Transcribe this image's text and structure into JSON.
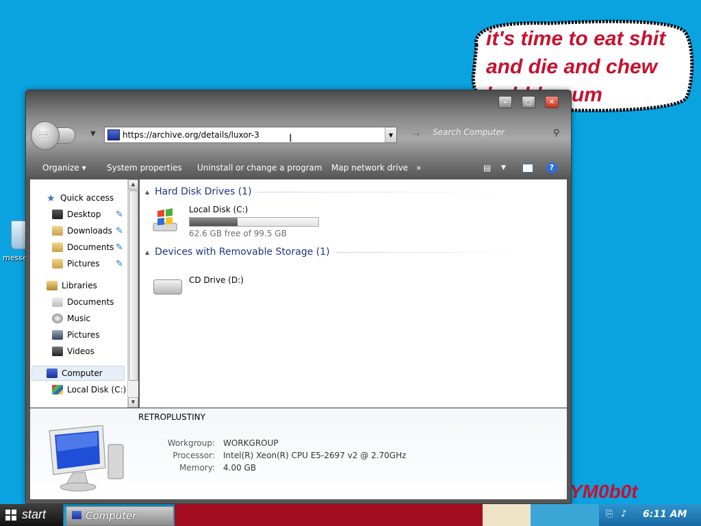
{
  "wallpaper": {
    "bubble_lines": [
      "it's time to eat shit",
      "and die and chew",
      "bubble gum"
    ],
    "graffiti": "YM0b0t"
  },
  "desktop": {
    "icon_label": "messe"
  },
  "window": {
    "address": "https://archive.org/details/luxor-3",
    "search_placeholder": "Search Computer",
    "toolbar": {
      "organize": "Organize ▾",
      "system_properties": "System properties",
      "uninstall": "Uninstall or change a program",
      "map_drive": "Map network drive",
      "more": "»"
    }
  },
  "nav": {
    "quick_access": "Quick access",
    "desktop": "Desktop",
    "downloads": "Downloads",
    "documents": "Documents",
    "pictures": "Pictures",
    "libraries": "Libraries",
    "lib_documents": "Documents",
    "music": "Music",
    "lib_pictures": "Pictures",
    "videos": "Videos",
    "computer": "Computer",
    "local_disk": "Local Disk (C:)"
  },
  "content": {
    "hdd_group": "Hard Disk Drives (1)",
    "c_name": "Local Disk (C:)",
    "c_free": "62.6 GB free of 99.5 GB",
    "c_used_fraction": 0.37,
    "removable_group": "Devices with Removable Storage (1)",
    "d_name": "CD Drive (D:)"
  },
  "details": {
    "computer_name": "RETROPLUSTINY",
    "workgroup_label": "Workgroup:",
    "workgroup": "WORKGROUP",
    "processor_label": "Processor:",
    "processor": "Intel(R) Xeon(R) CPU E5-2697 v2 @ 2.70GHz",
    "memory_label": "Memory:",
    "memory": "4.00 GB"
  },
  "taskbar": {
    "start": "start",
    "task": "Computer",
    "clock": "6:11 AM"
  },
  "colors": {
    "desktop": "#0aa3e0",
    "accent": "#1e3287",
    "bubble_text": "#c8102e"
  }
}
